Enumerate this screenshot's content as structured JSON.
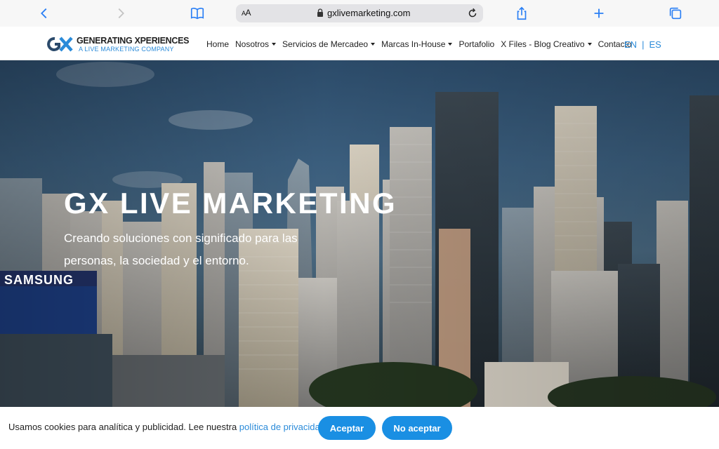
{
  "browser": {
    "text_size_label": "AA",
    "url": "gxlivemarketing.com"
  },
  "header": {
    "logo_title": "GENERATING XPERIENCES",
    "logo_subtitle": "A LIVE MARKETING COMPANY",
    "nav": [
      {
        "label": "Home",
        "dropdown": false
      },
      {
        "label": "Nosotros",
        "dropdown": true
      },
      {
        "label": "Servicios de Mercadeo",
        "dropdown": true
      },
      {
        "label": "Marcas In-House",
        "dropdown": true
      },
      {
        "label": "Portafolio",
        "dropdown": false
      },
      {
        "label": "X Files - Blog Creativo",
        "dropdown": true
      },
      {
        "label": "Contacto",
        "dropdown": false
      }
    ],
    "lang_en": "EN",
    "lang_sep": "|",
    "lang_es": "ES"
  },
  "hero": {
    "title": "GX LIVE MARKETING",
    "subtitle": "Creando soluciones con significado para las personas, la sociedad y el entorno.",
    "billboard_brand": "SAMSUNG"
  },
  "cookie": {
    "text": "Usamos cookies para analítica y publicidad. Lee nuestra ",
    "link": "política de privacidad",
    "end": ".",
    "accept_label": "Aceptar",
    "reject_label": "No aceptar"
  },
  "colors": {
    "accent": "#1a8fe3",
    "link": "#2b8bd9",
    "safari_blue": "#2a7ff5"
  }
}
